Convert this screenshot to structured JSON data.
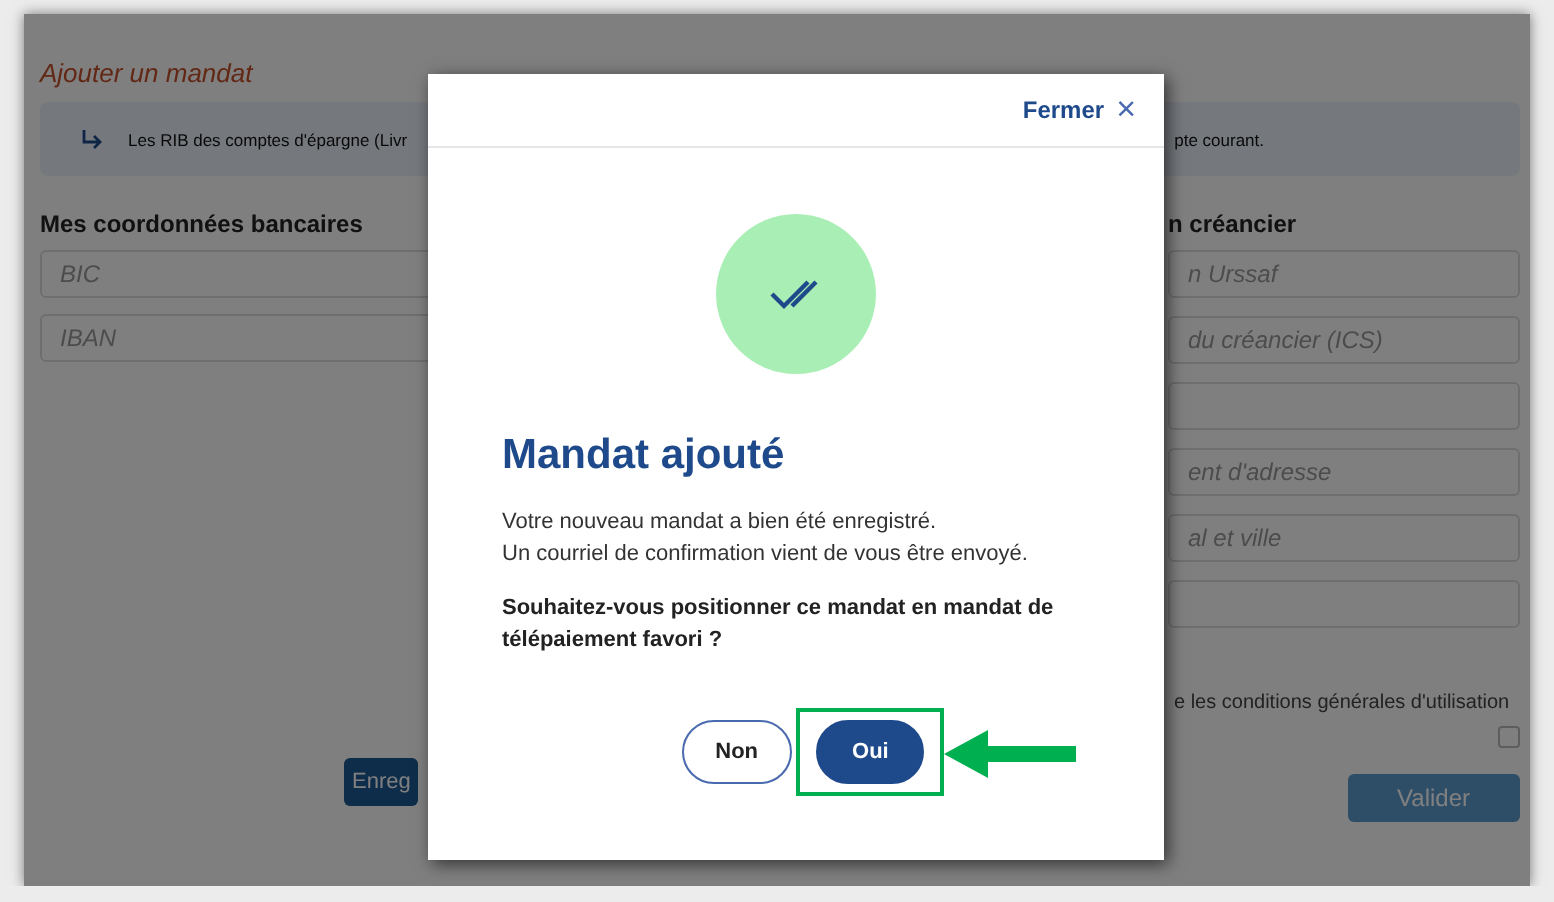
{
  "page": {
    "title": "Ajouter un mandat",
    "notice": {
      "text_left": "Les RIB des comptes d'épargne (Livr",
      "text_right": "pte courant."
    },
    "left_section": {
      "heading": "Mes coordonnées bancaires",
      "fields": [
        {
          "placeholder": "BIC"
        },
        {
          "placeholder": "IBAN"
        }
      ],
      "button": "Enreg"
    },
    "right_section": {
      "heading": "n créancier",
      "fields": [
        {
          "kind": "text",
          "placeholder": "n Urssaf"
        },
        {
          "kind": "text",
          "placeholder": "du créancier (ICS)"
        },
        {
          "kind": "empty"
        },
        {
          "kind": "text",
          "placeholder": "ent d'adresse"
        },
        {
          "kind": "text",
          "placeholder": "al et ville"
        },
        {
          "kind": "empty"
        }
      ],
      "terms": {
        "text": "e les conditions générales d'utilisation",
        "checked": false
      },
      "button": "Valider"
    }
  },
  "dialog": {
    "close_label": "Fermer",
    "close_symbol": "×",
    "title": "Mandat ajouté",
    "message_lines": [
      "Votre nouveau mandat a bien été enregistré.",
      "Un courriel de confirmation vient de vous être envoyé."
    ],
    "question": "Souhaitez-vous positionner ce mandat en mandat de télépaiement favori ?",
    "buttons": [
      {
        "label": "Non",
        "kind": "secondary",
        "highlighted": false
      },
      {
        "label": "Oui",
        "kind": "primary",
        "highlighted": true
      }
    ]
  }
}
